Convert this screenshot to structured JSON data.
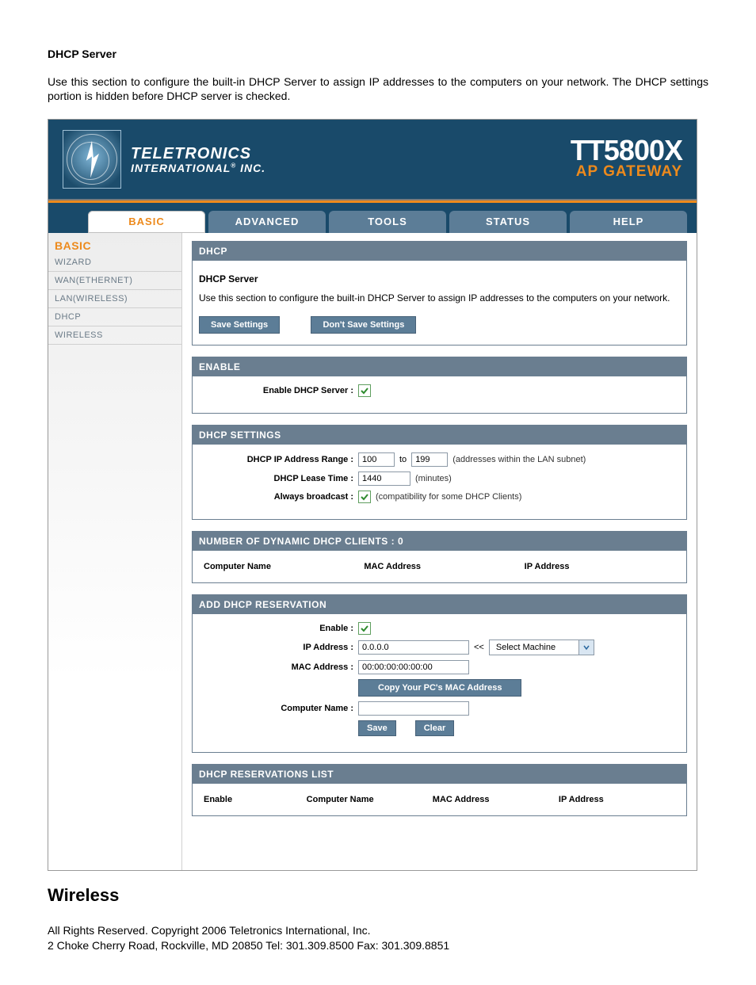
{
  "doc": {
    "title": "DHCP Server",
    "intro": "Use this section to configure the built-in DHCP Server to assign IP addresses to the computers on your network. The DHCP settings portion is hidden before DHCP server is checked.",
    "section_below": "Wireless",
    "copyright": "All Rights Reserved. Copyright 2006 Teletronics International, Inc.",
    "contact": "2 Choke Cherry Road, Rockville, MD 20850    Tel: 301.309.8500 Fax: 301.309.8851"
  },
  "brand": {
    "line1": "TELETRONICS",
    "line2": "INTERNATIONAL",
    "suffix": "INC.",
    "model": "TT5800X",
    "product": "AP GATEWAY"
  },
  "tabs": [
    {
      "label": "BASIC",
      "active": true
    },
    {
      "label": "ADVANCED",
      "active": false
    },
    {
      "label": "TOOLS",
      "active": false
    },
    {
      "label": "STATUS",
      "active": false
    },
    {
      "label": "HELP",
      "active": false
    }
  ],
  "sidebar": {
    "heading": "BASIC",
    "items": [
      {
        "label": "WIZARD"
      },
      {
        "label": "WAN(ETHERNET)"
      },
      {
        "label": "LAN(WIRELESS)"
      },
      {
        "label": "DHCP"
      },
      {
        "label": "WIRELESS"
      }
    ]
  },
  "dhcp_panel": {
    "title": "DHCP",
    "server_heading": "DHCP Server",
    "server_desc": "Use this section to configure the built-in DHCP Server to assign IP addresses to the computers on your network.",
    "save_btn": "Save Settings",
    "dont_save_btn": "Don't Save Settings"
  },
  "enable_panel": {
    "title": "ENABLE",
    "label": "Enable DHCP Server :",
    "checked": true
  },
  "settings_panel": {
    "title": "DHCP SETTINGS",
    "range_label": "DHCP IP Address Range :",
    "range_from": "100",
    "range_to_word": "to",
    "range_to": "199",
    "range_note": "(addresses within the LAN subnet)",
    "lease_label": "DHCP Lease Time :",
    "lease_value": "1440",
    "lease_unit": "(minutes)",
    "broadcast_label": "Always broadcast :",
    "broadcast_checked": true,
    "broadcast_note": "(compatibility for some DHCP Clients)"
  },
  "clients_panel": {
    "title": "NUMBER OF DYNAMIC DHCP CLIENTS : 0",
    "col1": "Computer Name",
    "col2": "MAC Address",
    "col3": "IP Address"
  },
  "reservation_panel": {
    "title": "ADD DHCP RESERVATION",
    "enable_label": "Enable :",
    "enable_checked": true,
    "ip_label": "IP Address :",
    "ip_value": "0.0.0.0",
    "ip_arrow": "<<",
    "select_placeholder": "Select Machine",
    "mac_label": "MAC Address :",
    "mac_value": "00:00:00:00:00:00",
    "copy_btn": "Copy Your PC's MAC Address",
    "name_label": "Computer Name :",
    "name_value": "",
    "save_btn": "Save",
    "clear_btn": "Clear"
  },
  "reservations_list_panel": {
    "title": "DHCP RESERVATIONS LIST",
    "col1": "Enable",
    "col2": "Computer Name",
    "col3": "MAC Address",
    "col4": "IP Address"
  }
}
